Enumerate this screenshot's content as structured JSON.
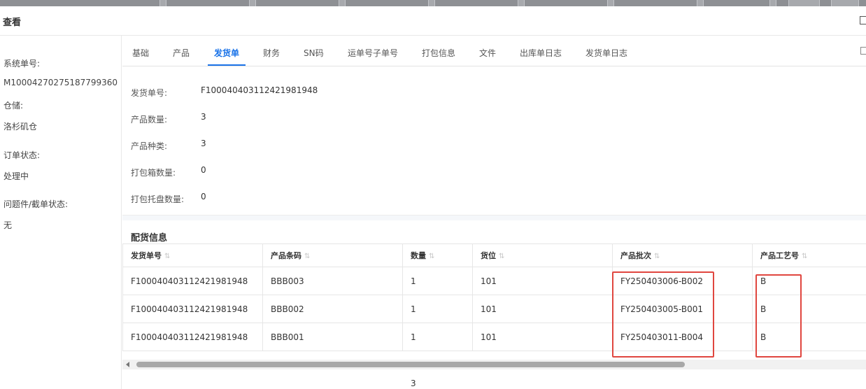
{
  "dialog": {
    "title": "查看"
  },
  "sidebar": {
    "order_no_label": "系统单号:",
    "order_no_value": "M10004270275187799360",
    "warehouse_label": "仓储:",
    "warehouse_value": "洛杉矶仓",
    "order_status_label": "订单状态:",
    "order_status_value": "处理中",
    "issue_label": "问题件/截单状态:",
    "issue_value": "无"
  },
  "tabs": [
    "基础",
    "产品",
    "发货单",
    "财务",
    "SN码",
    "运单号子单号",
    "打包信息",
    "文件",
    "出库单日志",
    "发货单日志"
  ],
  "active_tab": "发货单",
  "shipment": {
    "no_label": "发货单号:",
    "no_value": "F100040403112421981948",
    "qty_label": "产品数量:",
    "qty_value": "3",
    "kinds_label": "产品种类:",
    "kinds_value": "3",
    "boxes_label": "打包箱数量:",
    "boxes_value": "0",
    "pallets_label": "打包托盘数量:",
    "pallets_value": "0"
  },
  "allocation": {
    "title": "配货信息",
    "columns": [
      "发货单号",
      "产品条码",
      "数量",
      "货位",
      "产品批次",
      "产品工艺号"
    ],
    "rows": [
      [
        "F100040403112421981948",
        "BBB003",
        "1",
        "101",
        "FY250403006-B002",
        "B"
      ],
      [
        "F100040403112421981948",
        "BBB002",
        "1",
        "101",
        "FY250403005-B001",
        "B"
      ],
      [
        "F100040403112421981948",
        "BBB001",
        "1",
        "101",
        "FY250403011-B004",
        "B"
      ]
    ],
    "total_quantity": "3"
  },
  "colors": {
    "accent": "#1a73e8",
    "highlight_box": "#e0463f"
  },
  "icons": {
    "sort": "sort-icon",
    "maximize": "maximize-icon",
    "collapse": "collapse-icon"
  }
}
